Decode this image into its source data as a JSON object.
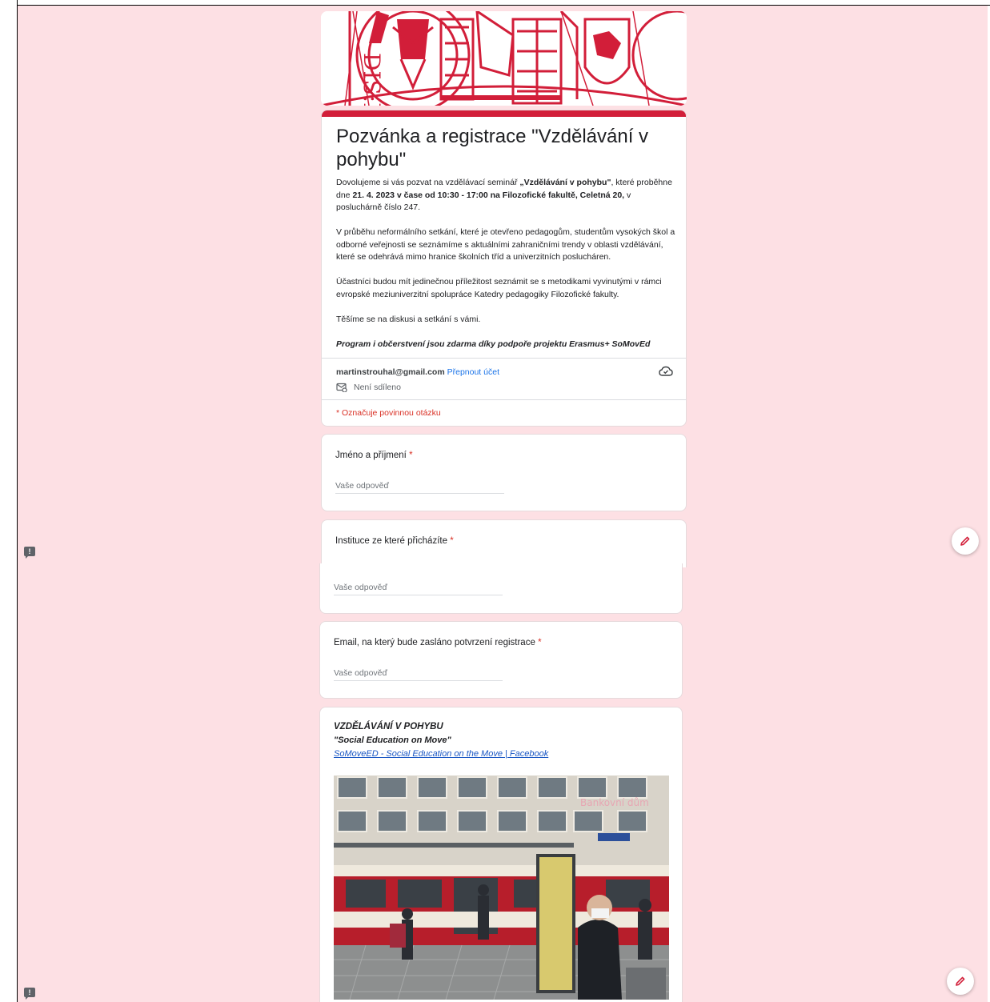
{
  "form": {
    "title": "Pozvánka a registrace \"Vzdělávání v pohybu\"",
    "desc": {
      "p1_a": "Dovolujeme si vás pozvat na vzdělávací seminář ",
      "p1_b": "„Vzdělávání v pohybu\"",
      "p1_c": ", které proběhne dne ",
      "p1_d": "21. 4. 2023 v čase od 10:30 - 17:00 na Filozofické fakultě, Celetná 20,",
      "p1_e": " v posluchárně číslo 247.",
      "p2": "V průběhu neformálního setkání, které je otevřeno pedagogům, studentům vysokých škol a odborné veřejnosti se seznámíme s aktuálními zahraničními trendy v oblasti vzdělávání, které se odehrává mimo hranice školních tříd a univerzitních poslucháren.",
      "p3": "Účastníci budou mít jedinečnou příležitost seznámit se s metodikami vyvinutými v rámci evropské meziuniverzitní spolupráce Katedry pedagogiky Filozofické fakulty.",
      "p4": "Těšíme se na diskusi a setkání s vámi.",
      "p5": "Program i občerstvení jsou zdarma díky podpoře projektu Erasmus+ SoMovEd"
    },
    "account_email": "martinstrouhal@gmail.com",
    "switch_account": "Přepnout účet",
    "not_shared": "Není sdíleno",
    "required_note": "* Označuje povinnou otázku"
  },
  "questions": [
    {
      "label": "Jméno a příjmení",
      "required": "*",
      "placeholder": "Vaše odpověď"
    },
    {
      "label": "Instituce ze které přicházíte",
      "required": "*",
      "placeholder": "Vaše odpověď"
    },
    {
      "label": "Email, na který bude zasláno potvrzení registrace",
      "required": "*",
      "placeholder": "Vaše odpověď"
    }
  ],
  "info": {
    "title": "VZDĚLÁVÁNÍ V POHYBU",
    "subtitle": "\"Social Education on Move\"",
    "link": "SoMoveED - Social Education on the Move | Facebook"
  },
  "photo": {
    "sign_text": "Bankovní dům"
  },
  "icons": {
    "feedback": "report-icon",
    "edit": "pencil-icon",
    "cloud": "cloud-done-icon",
    "not_shared": "not-shared-icon"
  },
  "colors": {
    "background": "#fde0e4",
    "accent": "#d21e39",
    "required": "#d93025",
    "link": "#1a73e8"
  }
}
